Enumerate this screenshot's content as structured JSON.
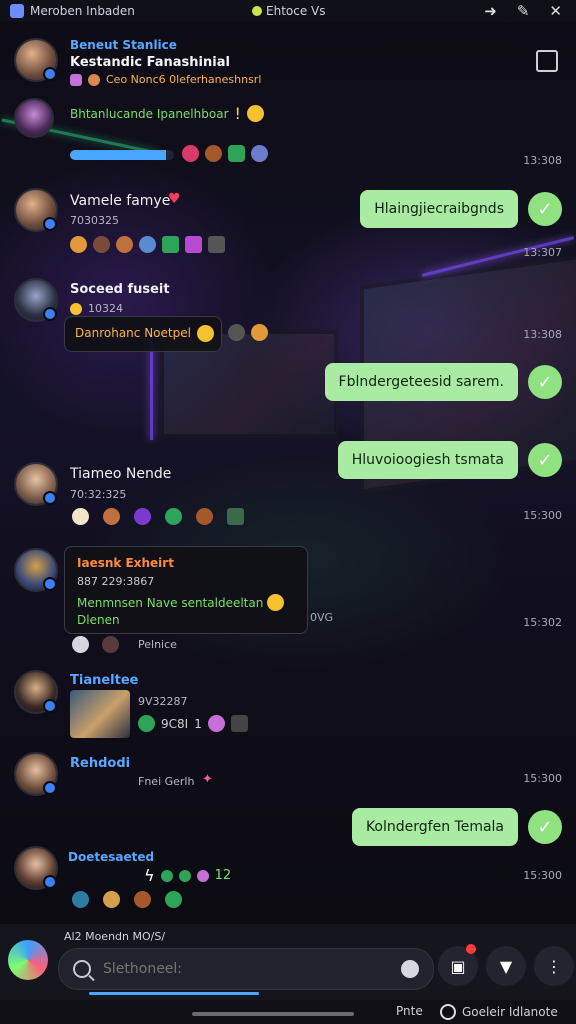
{
  "status_bar": {
    "app_title": "Meroben Inbaden",
    "center_label": "Ehtoce Vs"
  },
  "messages": [
    {
      "name": "Beneut Stanlice",
      "line1": "Kestandic Fanashinial",
      "line2": "Ceo Nonc6 0leferhaneshnsrl",
      "line3": "Bhtanlucande Ipanelhboar"
    },
    {
      "name": "Vamele famye",
      "sub": "7030325"
    },
    {
      "name": "Soceed fuseit",
      "sub": "10324",
      "card_text": "Danrohanc Noetpel"
    },
    {
      "name": "Tiameo Nende",
      "sub": "70:32:325"
    },
    {
      "name": "Iaesnk Exheirt",
      "sub": "887 229:3867",
      "card_text": "Menmnsen Nave sentaldeeltan",
      "card_text2": "Dlenen",
      "overflow": "0VG",
      "below": "Pelnice"
    },
    {
      "name": "Tianeltee",
      "sub": "9V32287",
      "extra": "9C8I",
      "extra_num": "1"
    },
    {
      "name": "Rehdodi",
      "sub": "Fnei Gerlh"
    },
    {
      "name": "Doetesaeted",
      "extra": "12"
    }
  ],
  "outgoing": [
    {
      "text": "Hlaingjiecraibgnds"
    },
    {
      "text": "Fblndergeteesid sarem."
    },
    {
      "text": "Hluvoioogiesh tsmata"
    },
    {
      "text": "Kolndergfen Temala"
    }
  ],
  "times": [
    "13:308",
    "13:307",
    "13:308",
    "15:300",
    "15:302",
    "15:300",
    "15:300"
  ],
  "progress": 0.92,
  "compose": {
    "hint": "Al2 Moendn MO/S/",
    "placeholder": "Slethoneel:"
  },
  "nav": {
    "left": "Pnte",
    "right": "Goeleir Idlanote"
  },
  "colors": {
    "outgoing_bubble": "#a9eba3",
    "accent_green": "#79e06a",
    "accent_blue": "#5aa7ff",
    "accent_orange": "#ff8a3d"
  }
}
